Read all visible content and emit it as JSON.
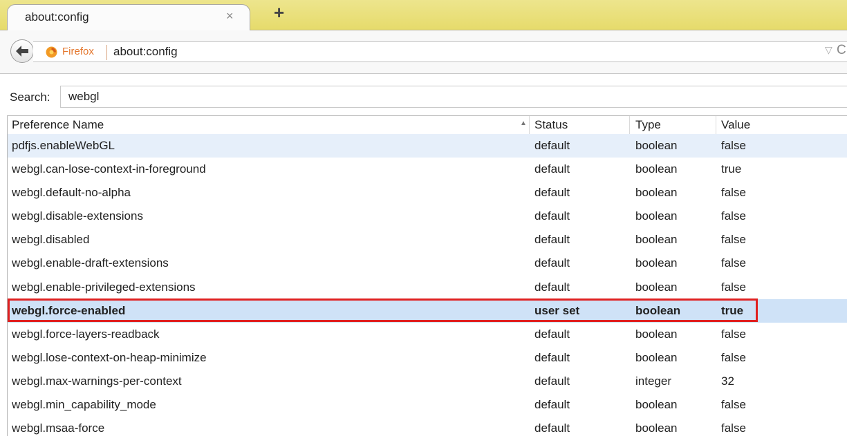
{
  "tab": {
    "title": "about:config",
    "close_glyph": "×",
    "newtab_glyph": "+"
  },
  "navbar": {
    "identity_label": "Firefox",
    "url": "about:config",
    "dropmarker_glyph": "▽",
    "reload_glyph": "C"
  },
  "search": {
    "label": "Search:",
    "value": "webgl"
  },
  "table": {
    "headers": {
      "name": "Preference Name",
      "status": "Status",
      "type": "Type",
      "value": "Value",
      "sort_glyph": "▲"
    },
    "rows": [
      {
        "name": "pdfjs.enableWebGL",
        "status": "default",
        "type": "boolean",
        "value": "false"
      },
      {
        "name": "webgl.can-lose-context-in-foreground",
        "status": "default",
        "type": "boolean",
        "value": "true"
      },
      {
        "name": "webgl.default-no-alpha",
        "status": "default",
        "type": "boolean",
        "value": "false"
      },
      {
        "name": "webgl.disable-extensions",
        "status": "default",
        "type": "boolean",
        "value": "false"
      },
      {
        "name": "webgl.disabled",
        "status": "default",
        "type": "boolean",
        "value": "false"
      },
      {
        "name": "webgl.enable-draft-extensions",
        "status": "default",
        "type": "boolean",
        "value": "false"
      },
      {
        "name": "webgl.enable-privileged-extensions",
        "status": "default",
        "type": "boolean",
        "value": "false"
      },
      {
        "name": "webgl.force-enabled",
        "status": "user set",
        "type": "boolean",
        "value": "true"
      },
      {
        "name": "webgl.force-layers-readback",
        "status": "default",
        "type": "boolean",
        "value": "false"
      },
      {
        "name": "webgl.lose-context-on-heap-minimize",
        "status": "default",
        "type": "boolean",
        "value": "false"
      },
      {
        "name": "webgl.max-warnings-per-context",
        "status": "default",
        "type": "integer",
        "value": "32"
      },
      {
        "name": "webgl.min_capability_mode",
        "status": "default",
        "type": "boolean",
        "value": "false"
      },
      {
        "name": "webgl.msaa-force",
        "status": "default",
        "type": "boolean",
        "value": "false"
      }
    ]
  },
  "colors": {
    "tabstrip": "#e6db6b",
    "highlight_box": "#e02020",
    "selected_row": "#cfe2f7",
    "identity": "#e4762c"
  },
  "icons": {
    "back": "back-arrow-icon",
    "identity": "firefox-icon",
    "reload": "reload-icon",
    "close": "close-icon",
    "newtab": "plus-icon"
  }
}
